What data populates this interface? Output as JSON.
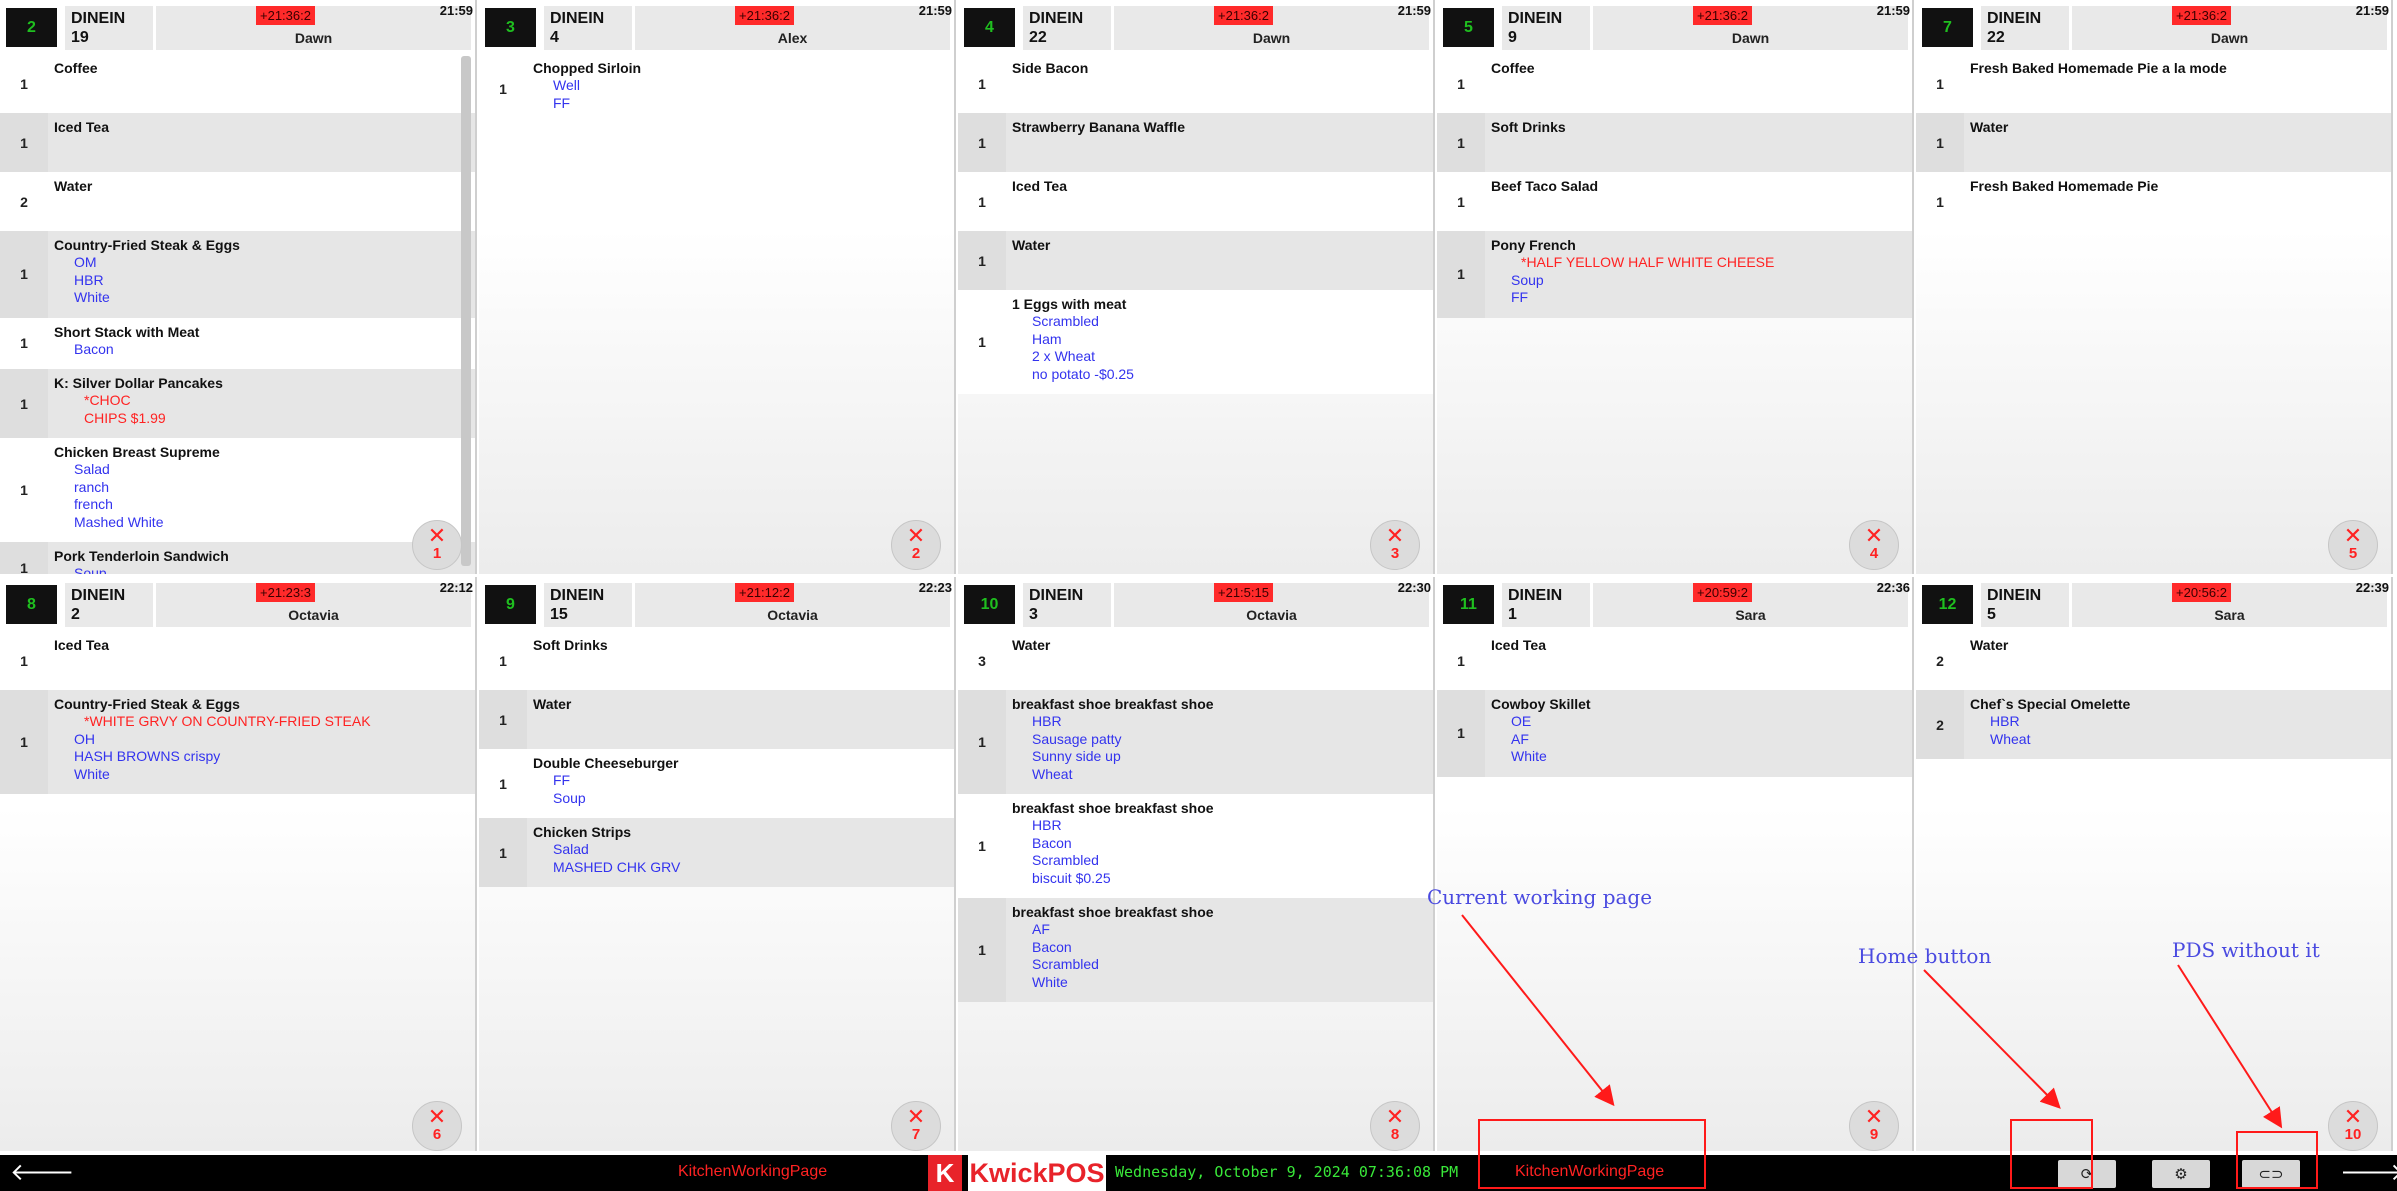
{
  "tickets": [
    {
      "num": "2",
      "type": "DINEIN",
      "table": "19",
      "timer": "+21:36:2",
      "server": "Dawn",
      "time": "21:59",
      "close": "1",
      "items": [
        {
          "qty": "1",
          "name": "Coffee",
          "mods": []
        },
        {
          "qty": "1",
          "name": "Iced Tea",
          "mods": []
        },
        {
          "qty": "2",
          "name": "Water",
          "mods": []
        },
        {
          "qty": "1",
          "name": "Country-Fried Steak & Eggs",
          "mods": [
            {
              "t": "OM"
            },
            {
              "t": "HBR"
            },
            {
              "t": "White"
            }
          ]
        },
        {
          "qty": "1",
          "name": "Short Stack with Meat",
          "mods": [
            {
              "t": "Bacon"
            }
          ]
        },
        {
          "qty": "1",
          "name": "K: Silver Dollar Pancakes",
          "mods": [
            {
              "t": "*CHOC",
              "red": true
            },
            {
              "t": "CHIPS $1.99",
              "red": true
            }
          ]
        },
        {
          "qty": "1",
          "name": "Chicken Breast Supreme",
          "mods": [
            {
              "t": "Salad"
            },
            {
              "t": "ranch"
            },
            {
              "t": "french"
            },
            {
              "t": "Mashed White"
            }
          ]
        },
        {
          "qty": "1",
          "name": "Pork Tenderloin Sandwich",
          "mods": [
            {
              "t": "Soup"
            }
          ]
        }
      ]
    },
    {
      "num": "3",
      "type": "DINEIN",
      "table": "4",
      "timer": "+21:36:2",
      "server": "Alex",
      "time": "21:59",
      "close": "2",
      "items": [
        {
          "qty": "1",
          "name": "Chopped Sirloin",
          "mods": [
            {
              "t": "Well"
            },
            {
              "t": "FF"
            }
          ]
        }
      ]
    },
    {
      "num": "4",
      "type": "DINEIN",
      "table": "22",
      "timer": "+21:36:2",
      "server": "Dawn",
      "time": "21:59",
      "close": "3",
      "items": [
        {
          "qty": "1",
          "name": "Side Bacon",
          "mods": []
        },
        {
          "qty": "1",
          "name": "Strawberry Banana Waffle",
          "mods": []
        },
        {
          "qty": "1",
          "name": "Iced Tea",
          "mods": []
        },
        {
          "qty": "1",
          "name": "Water",
          "mods": []
        },
        {
          "qty": "1",
          "name": "1 Eggs with meat",
          "mods": [
            {
              "t": "Scrambled"
            },
            {
              "t": "Ham"
            },
            {
              "t": "2 x Wheat"
            },
            {
              "t": "no potato -$0.25"
            }
          ]
        }
      ]
    },
    {
      "num": "5",
      "type": "DINEIN",
      "table": "9",
      "timer": "+21:36:2",
      "server": "Dawn",
      "time": "21:59",
      "close": "4",
      "items": [
        {
          "qty": "1",
          "name": "Coffee",
          "mods": []
        },
        {
          "qty": "1",
          "name": "Soft Drinks",
          "mods": []
        },
        {
          "qty": "1",
          "name": "Beef Taco Salad",
          "mods": []
        },
        {
          "qty": "1",
          "name": "Pony French",
          "mods": [
            {
              "t": "*HALF YELLOW HALF WHITE CHEESE",
              "red": true
            },
            {
              "t": "Soup"
            },
            {
              "t": "FF"
            }
          ]
        }
      ]
    },
    {
      "num": "7",
      "type": "DINEIN",
      "table": "22",
      "timer": "+21:36:2",
      "server": "Dawn",
      "time": "21:59",
      "close": "5",
      "items": [
        {
          "qty": "1",
          "name": "Fresh Baked Homemade Pie a la mode",
          "mods": []
        },
        {
          "qty": "1",
          "name": "Water",
          "mods": []
        },
        {
          "qty": "1",
          "name": "Fresh Baked Homemade Pie",
          "mods": []
        }
      ]
    },
    {
      "num": "8",
      "type": "DINEIN",
      "table": "2",
      "timer": "+21:23:3",
      "server": "Octavia",
      "time": "22:12",
      "close": "6",
      "items": [
        {
          "qty": "1",
          "name": "Iced Tea",
          "mods": []
        },
        {
          "qty": "1",
          "name": "Country-Fried Steak & Eggs",
          "mods": [
            {
              "t": "*WHITE GRVY ON COUNTRY-FRIED STEAK",
              "red": true
            },
            {
              "t": "OH"
            },
            {
              "t": "HASH BROWNS crispy"
            },
            {
              "t": "White"
            }
          ]
        }
      ]
    },
    {
      "num": "9",
      "type": "DINEIN",
      "table": "15",
      "timer": "+21:12:2",
      "server": "Octavia",
      "time": "22:23",
      "close": "7",
      "items": [
        {
          "qty": "1",
          "name": "Soft Drinks",
          "mods": []
        },
        {
          "qty": "1",
          "name": "Water",
          "mods": []
        },
        {
          "qty": "1",
          "name": "Double Cheeseburger",
          "mods": [
            {
              "t": "FF"
            },
            {
              "t": "Soup"
            }
          ]
        },
        {
          "qty": "1",
          "name": "Chicken Strips",
          "mods": [
            {
              "t": "Salad"
            },
            {
              "t": "MASHED CHK GRV"
            }
          ]
        }
      ]
    },
    {
      "num": "10",
      "type": "DINEIN",
      "table": "3",
      "timer": "+21:5:15",
      "server": "Octavia",
      "time": "22:30",
      "close": "8",
      "items": [
        {
          "qty": "3",
          "name": "Water",
          "mods": []
        },
        {
          "qty": "1",
          "name": "breakfast shoe breakfast shoe",
          "mods": [
            {
              "t": "HBR"
            },
            {
              "t": "Sausage patty"
            },
            {
              "t": "Sunny side up"
            },
            {
              "t": "Wheat"
            }
          ]
        },
        {
          "qty": "1",
          "name": "breakfast shoe breakfast shoe",
          "mods": [
            {
              "t": "HBR"
            },
            {
              "t": "Bacon"
            },
            {
              "t": "Scrambled"
            },
            {
              "t": "biscuit $0.25"
            }
          ]
        },
        {
          "qty": "1",
          "name": "breakfast shoe breakfast shoe",
          "mods": [
            {
              "t": "AF"
            },
            {
              "t": "Bacon"
            },
            {
              "t": "Scrambled"
            },
            {
              "t": "White"
            }
          ]
        }
      ]
    },
    {
      "num": "11",
      "type": "DINEIN",
      "table": "1",
      "timer": "+20:59:2",
      "server": "Sara",
      "time": "22:36",
      "close": "9",
      "items": [
        {
          "qty": "1",
          "name": "Iced Tea",
          "mods": []
        },
        {
          "qty": "1",
          "name": "Cowboy Skillet",
          "mods": [
            {
              "t": "OE"
            },
            {
              "t": "AF"
            },
            {
              "t": "White"
            }
          ]
        }
      ]
    },
    {
      "num": "12",
      "type": "DINEIN",
      "table": "5",
      "timer": "+20:56:2",
      "server": "Sara",
      "time": "22:39",
      "close": "10",
      "items": [
        {
          "qty": "2",
          "name": "Water",
          "mods": []
        },
        {
          "qty": "2",
          "name": "Chef`s Special Omelette",
          "mods": [
            {
              "t": "HBR"
            },
            {
              "t": "Wheat"
            }
          ]
        }
      ]
    }
  ],
  "bottom_bar": {
    "left_label": "KitchenWorkingPage",
    "logo_letter": "K",
    "logo_text": "KwickPOS",
    "datetime": "Wednesday, October 9, 2024 07:36:08 PM",
    "right_label": "KitchenWorkingPage",
    "refresh_icon": "⟳",
    "settings_icon": "⚙",
    "toggle_icon": "⊂⊃",
    "prev_icon": "🡐",
    "next_icon": "🡒"
  },
  "annotations": {
    "current_page": "Current working page",
    "home_button": "Home button",
    "pds": "PDS without it"
  },
  "colors": {
    "accent_red": "#ff2222",
    "ticket_number_green": "#1fbf1f",
    "modifier_blue": "#3333ee",
    "datetime_green": "#39e839"
  }
}
